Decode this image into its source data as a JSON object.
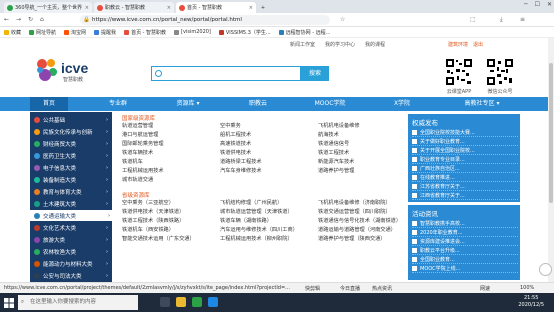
{
  "browser": {
    "tabs": [
      {
        "label": "360导航_一个主页，整个世界",
        "active": false
      },
      {
        "label": "职教云 - 智慧职教",
        "active": false
      },
      {
        "label": "首页 - 智慧职教",
        "active": true
      }
    ],
    "url": "https://www.icve.com.cn/portal_new/portal/portal.html",
    "bookmarks": [
      "收藏",
      "网址导航",
      "淘宝网",
      "提醒我",
      "首页 - 智慧职教",
      "[visim2020]",
      "VISSIM5.3（学生...",
      "远程智协网 - 远程..."
    ]
  },
  "header": {
    "top_links": [
      "新闻工作室",
      "我的学习中心",
      "我的课程"
    ],
    "user_links": [
      "建筑环境",
      "退出"
    ],
    "logo_text": "icve",
    "logo_sub": "智慧职教",
    "search_placeholder": "",
    "search_button": "搜索",
    "qr_labels": [
      "云课堂APP",
      "微信公众号"
    ]
  },
  "nav": {
    "items": [
      "首页",
      "专业群",
      "资源库",
      "职教云",
      "MOOC学院",
      "X学院",
      "高教社专区"
    ],
    "active_index": 0
  },
  "sidebar": {
    "items": [
      "公共基础",
      "民族文化传承与创新",
      "财经商贸大类",
      "医药卫生大类",
      "电子信息大类",
      "装备制造大类",
      "教育与体育大类",
      "土木建筑大类",
      "交通运输大类",
      "文化艺术大类",
      "旅游大类",
      "农林牧渔大类",
      "能源动力与材料大类",
      "公安与司法大类"
    ],
    "active_index": 8
  },
  "content": {
    "sections": [
      {
        "title": "国家级资源库",
        "rows": [
          [
            "轨道运营管理",
            "空中乘务",
            "飞机机电设备维修"
          ],
          [
            "港口与航运管理",
            "船机工程技术",
            "航海技术"
          ],
          [
            "国际邮轮乘务管理",
            "高速铁道技术",
            "铁道通信信号"
          ],
          [
            "铁道车辆技术",
            "铁道供电技术",
            "铁道工程技术"
          ],
          [
            "铁道机车",
            "道路桥梁工程技术",
            "新能源汽车技术"
          ],
          [
            "工程机械运用技术",
            "汽车车身维修技术",
            "道路养护与管理"
          ],
          [
            "城市轨道交通",
            "",
            ""
          ]
        ]
      },
      {
        "title": "省级资源库",
        "rows": [
          [
            "空中乘务（三亚航空）",
            "飞机结构修理（广州民航）",
            "飞机机电设备维修（济南职院）"
          ],
          [
            "铁道供电技术（天津铁道）",
            "城市轨道运营管理（天津铁道）",
            "铁道交通运营管理（四川职院）"
          ],
          [
            "铁道工程技术（陕西铁路）",
            "铁道车辆（湖南铁路）",
            "铁道通信与信号化技术（湖南铁道）"
          ],
          [
            "铁道机车（西安铁路）",
            "汽车运用与维修技术（四川工商）",
            "道路运输与道路管理（河南交通）"
          ],
          [
            "智能交通技术运用（广东交通）",
            "工程机械运用技术（柳州职院）",
            "道路养护与管理（陕西交通）"
          ]
        ]
      }
    ]
  },
  "right_panels": [
    {
      "title": "权威发布",
      "items": [
        "全国职业院校技能大赛...",
        "关于做好职业教育...",
        "关于开展全国职业院校...",
        "职业教育专业目录...",
        "广西壮族自治区...",
        "在线教育推进...",
        "江苏省教育厅关于...",
        "江西省教育厅关于..."
      ]
    },
    {
      "title": "活动资讯",
      "items": [
        "智慧职教携手高校...",
        "2020年职业教育...",
        "资源库建设推进会...",
        "职教云平台升级...",
        "全国职业教育...",
        "MOOC学院上线..."
      ]
    }
  ],
  "status": {
    "url": "https://www.icve.com.cn/portal/project/themes/default/2zmlasvmly/j/s/zyhvxkt/s/ite_page/index.html?projectId=...",
    "items": [
      "快剪辑",
      "今日直播",
      "热点资讯",
      "网速",
      "100%"
    ]
  },
  "taskbar": {
    "search_placeholder": "在这里输入你要搜索的内容",
    "time": "21:55",
    "date": "2020/12/5"
  },
  "colors": {
    "nav_blue": "#2a8bd4",
    "sidebar_navy": "#1a3c68",
    "accent_orange": "#e0561b",
    "taskbar": "#1f2b3a"
  }
}
